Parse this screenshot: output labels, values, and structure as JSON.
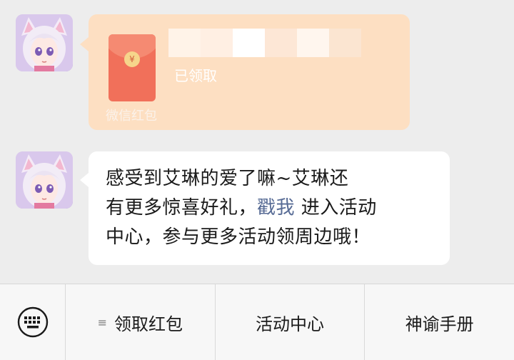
{
  "messages": [
    {
      "type": "red_packet",
      "status": "已领取",
      "footer": "微信红包",
      "colors": {
        "card": "#fddfc2",
        "packet": "#f1705a"
      },
      "coin_glyph": "¥"
    },
    {
      "type": "text",
      "lines": [
        "感受到艾琳的爱了嘛~艾琳还",
        "有更多惊喜好礼，",
        "戳我",
        "进入活动",
        "中心，参与更多活动领周边哦！"
      ],
      "link_color": "#576b95"
    }
  ],
  "menu": {
    "keyboard_icon": "keyboard-icon",
    "submenu_icon": "≡",
    "items": [
      "领取红包",
      "活动中心",
      "神谕手册"
    ]
  }
}
